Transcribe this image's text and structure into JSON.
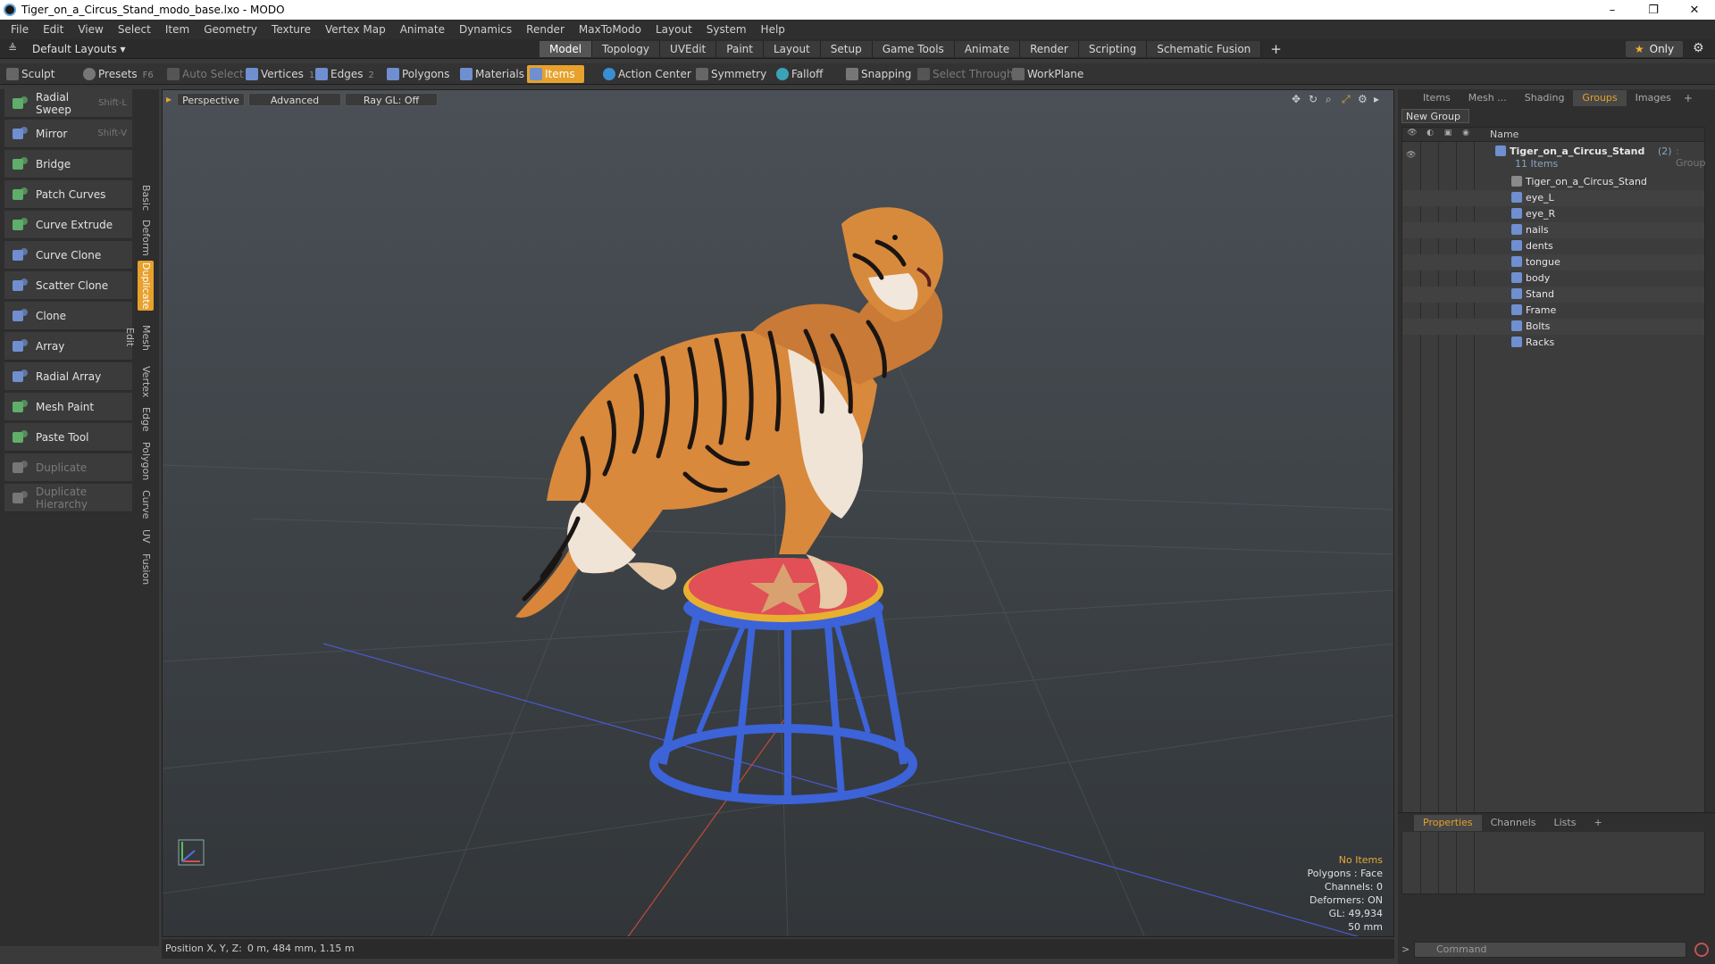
{
  "window": {
    "title": "Tiger_on_a_Circus_Stand_modo_base.lxo - MODO",
    "controls": [
      "–",
      "❐",
      "✕"
    ]
  },
  "menu": [
    "File",
    "Edit",
    "View",
    "Select",
    "Item",
    "Geometry",
    "Texture",
    "Vertex Map",
    "Animate",
    "Dynamics",
    "Render",
    "MaxToModo",
    "Layout",
    "System",
    "Help"
  ],
  "layout_bar": {
    "layout_select": "Default Layouts ▾",
    "tabs": [
      {
        "label": "Model",
        "active": true
      },
      {
        "label": "Topology"
      },
      {
        "label": "UVEdit"
      },
      {
        "label": "Paint"
      },
      {
        "label": "Layout"
      },
      {
        "label": "Setup"
      },
      {
        "label": "Game Tools"
      },
      {
        "label": "Animate"
      },
      {
        "label": "Render"
      },
      {
        "label": "Scripting"
      },
      {
        "label": "Schematic Fusion"
      }
    ],
    "add_tab": "+",
    "only_label": "Only",
    "only_star": "★"
  },
  "toolbar": {
    "sculpt": "Sculpt",
    "presets": "Presets",
    "presets_key": "F6",
    "auto_select": "Auto Select",
    "vertices": "Vertices",
    "vertices_count": "1",
    "edges": "Edges",
    "edges_count": "2",
    "polygons": "Polygons",
    "materials": "Materials",
    "items": "Items",
    "action_center": "Action Center",
    "symmetry": "Symmetry",
    "falloff": "Falloff",
    "snapping": "Snapping",
    "select_through": "Select Through",
    "workplane": "WorkPlane"
  },
  "tools": [
    {
      "label": "Radial Sweep",
      "shortcut": "Shift-L",
      "icon": "radial-sweep-icon",
      "color": "#5fae6a"
    },
    {
      "label": "Mirror",
      "shortcut": "Shift-V",
      "icon": "mirror-icon",
      "color": "#6f8fd0"
    },
    {
      "label": "Bridge",
      "shortcut": "",
      "icon": "bridge-icon",
      "color": "#5fae6a"
    },
    {
      "label": "Patch Curves",
      "shortcut": "",
      "icon": "patch-curves-icon",
      "color": "#5fae6a"
    },
    {
      "label": "Curve Extrude",
      "shortcut": "",
      "icon": "curve-extrude-icon",
      "color": "#5fae6a"
    },
    {
      "label": "Curve Clone",
      "shortcut": "",
      "icon": "curve-clone-icon",
      "color": "#6f8fd0"
    },
    {
      "label": "Scatter Clone",
      "shortcut": "",
      "icon": "scatter-clone-icon",
      "color": "#6f8fd0"
    },
    {
      "label": "Clone",
      "shortcut": "",
      "icon": "clone-icon",
      "color": "#6f8fd0"
    },
    {
      "label": "Array",
      "shortcut": "",
      "icon": "array-icon",
      "color": "#6f8fd0"
    },
    {
      "label": "Radial Array",
      "shortcut": "",
      "icon": "radial-array-icon",
      "color": "#6f8fd0"
    },
    {
      "label": "Mesh Paint",
      "shortcut": "",
      "icon": "mesh-paint-icon",
      "color": "#5fae6a"
    },
    {
      "label": "Paste Tool",
      "shortcut": "",
      "icon": "paste-tool-icon",
      "color": "#5fae6a"
    },
    {
      "label": "Duplicate",
      "shortcut": "",
      "icon": "duplicate-icon",
      "color": "#777777",
      "disabled": true
    },
    {
      "label": "Duplicate Hierarchy",
      "shortcut": "",
      "icon": "duplicate-hierarchy-icon",
      "color": "#777777",
      "disabled": true
    }
  ],
  "side_tabs": [
    "Basic",
    "Deform",
    "Duplicate",
    "Mesh Edit",
    "Vertex",
    "Edge",
    "Polygon",
    "Curve",
    "UV",
    "Fusion"
  ],
  "viewport": {
    "perspective": "Perspective",
    "advanced": "Advanced",
    "raygl": "Ray GL: Off",
    "info": {
      "no_items": "No Items",
      "polygons": "Polygons : Face",
      "channels": "Channels: 0",
      "deformers": "Deformers: ON",
      "gl": "GL: 49,934",
      "scale": "50 mm"
    }
  },
  "status": {
    "label": "Position X, Y, Z:",
    "value": "0 m, 484 mm, 1.15 m"
  },
  "right_tabs": [
    {
      "label": "Items"
    },
    {
      "label": "Mesh ..."
    },
    {
      "label": "Shading"
    },
    {
      "label": "Groups",
      "active": true
    },
    {
      "label": "Images"
    }
  ],
  "groups": {
    "new_group": "New Group",
    "name_header": "Name",
    "root": {
      "label": "Tiger_on_a_Circus_Stand",
      "count": "(2)",
      "type": ": Group",
      "sub": "11 Items"
    },
    "items": [
      "Tiger_on_a_Circus_Stand",
      "eye_L",
      "eye_R",
      "nails",
      "dents",
      "tongue",
      "body",
      "Stand",
      "Frame",
      "Bolts",
      "Racks"
    ]
  },
  "bottom_tabs": [
    {
      "label": "Properties",
      "active": true
    },
    {
      "label": "Channels"
    },
    {
      "label": "Lists"
    }
  ],
  "command_placeholder": "Command",
  "colors": {
    "accent": "#e7a12c",
    "bg": "#3a3a3a"
  }
}
